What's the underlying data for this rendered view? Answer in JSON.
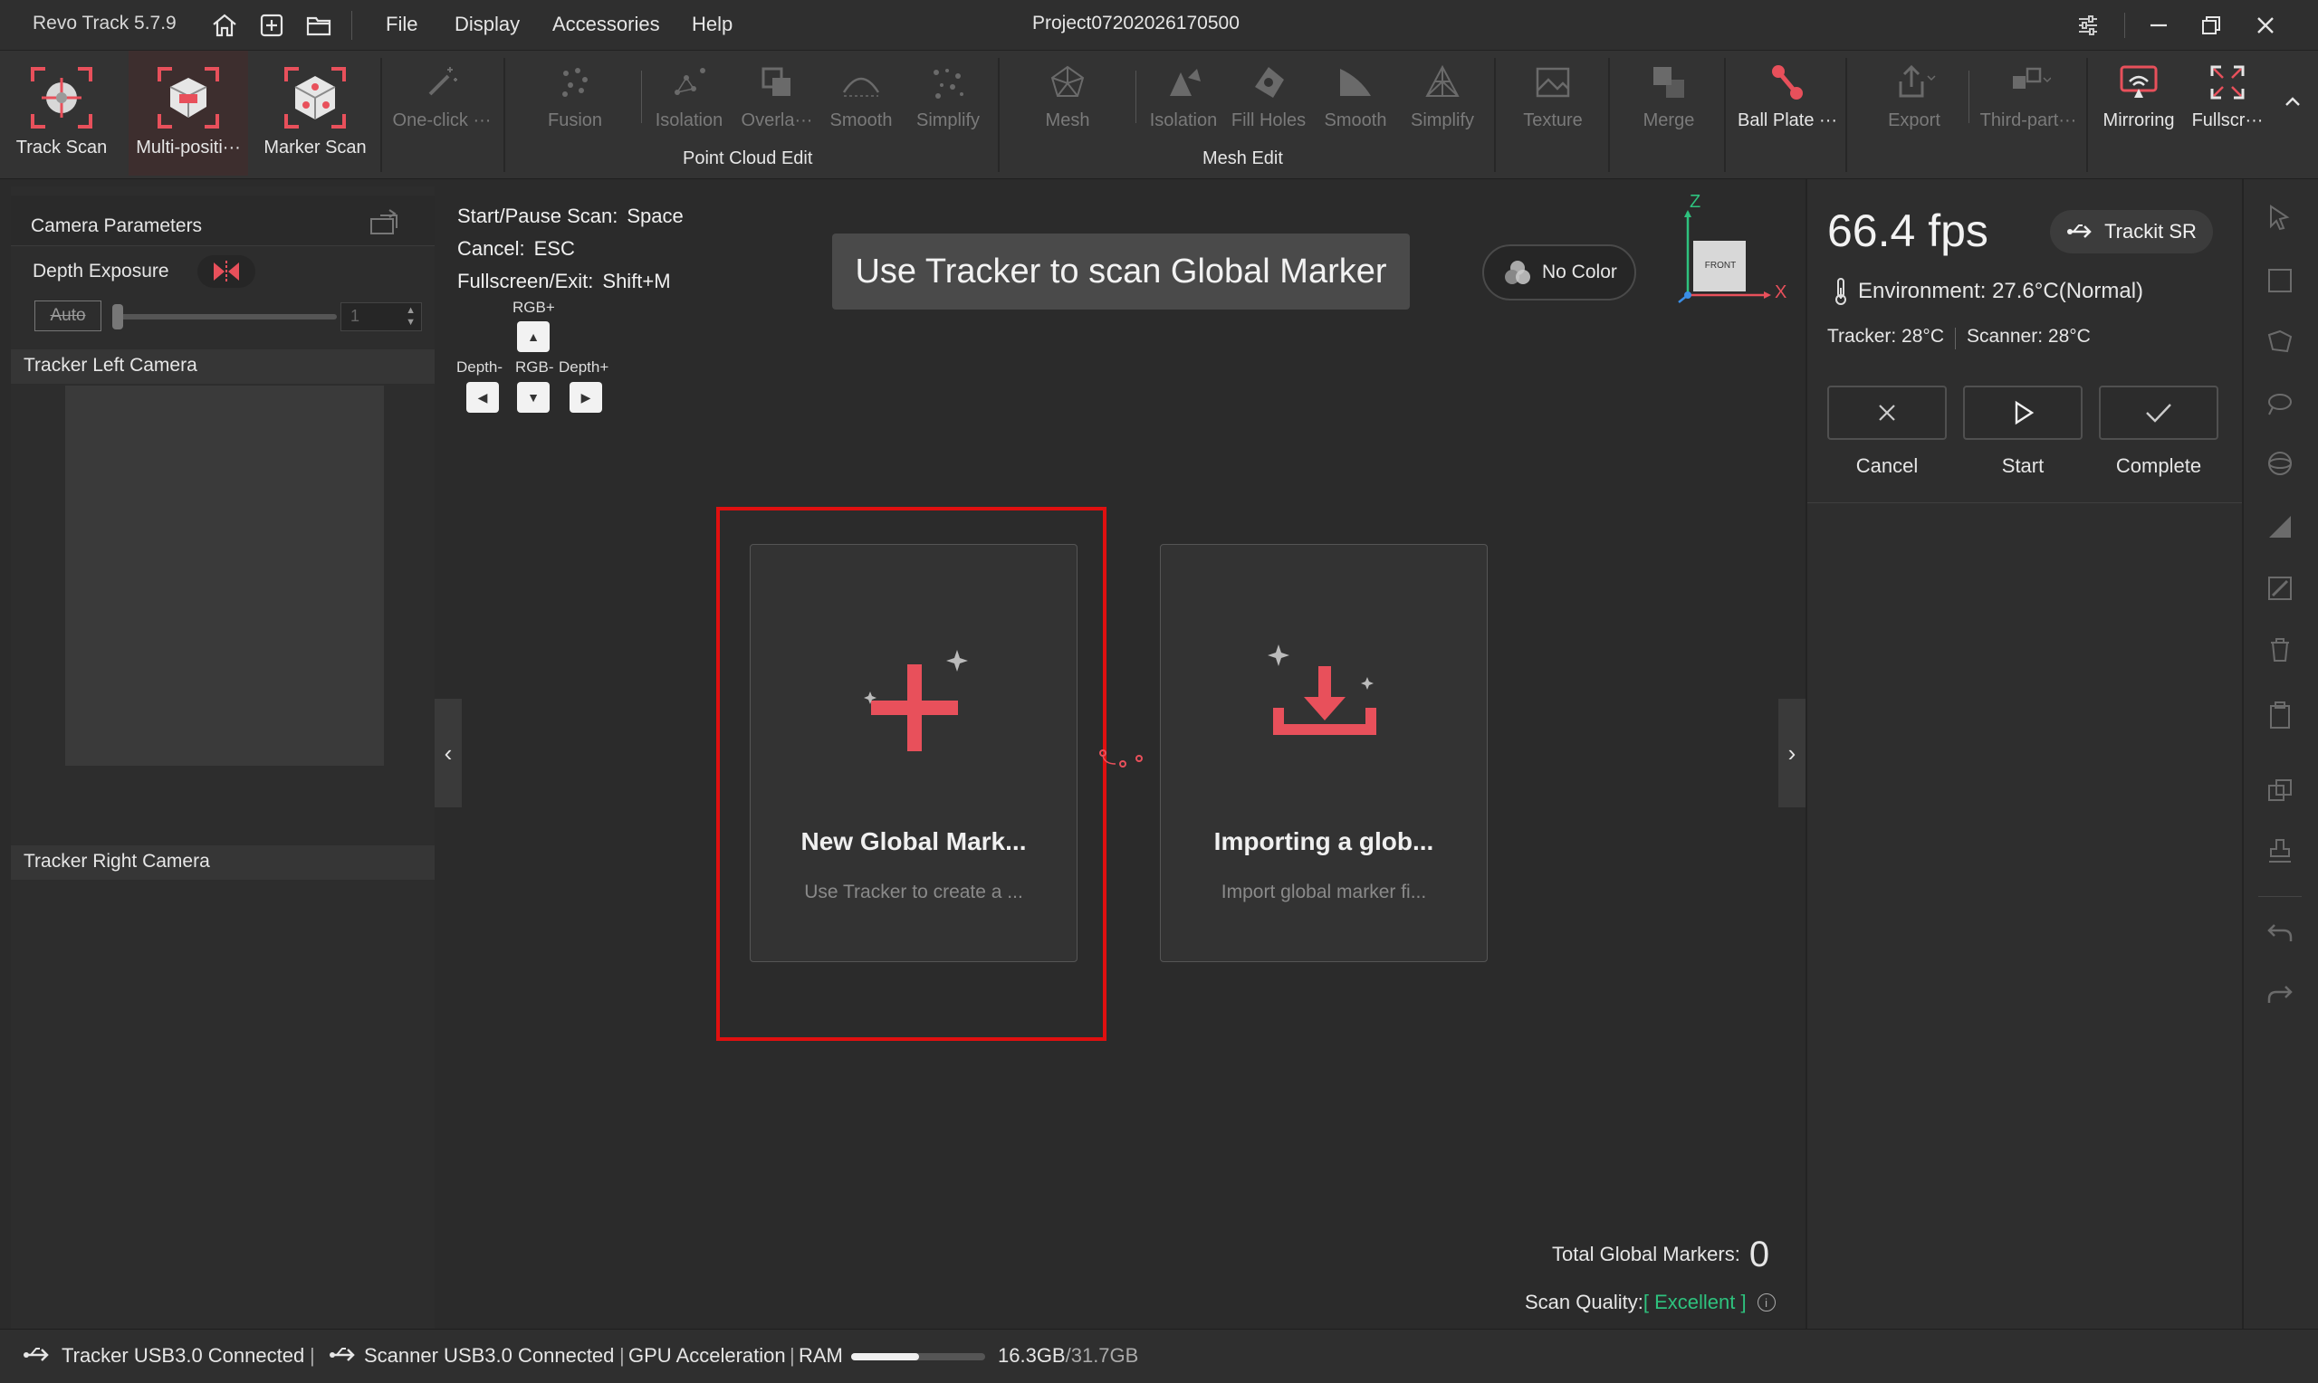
{
  "titlebar": {
    "app_title": "Revo Track 5.7.9",
    "menu": [
      "File",
      "Display",
      "Accessories",
      "Help"
    ],
    "project": "Project07202026170500"
  },
  "toolbar": {
    "scan_modes": [
      "Track Scan",
      "Multi-positi···",
      "Marker Scan"
    ],
    "one_click": "One-click ···",
    "point_cloud_tools": [
      "Fusion",
      "Isolation",
      "Overla···",
      "Smooth",
      "Simplify"
    ],
    "point_cloud_group": "Point Cloud Edit",
    "mesh_tools": [
      "Mesh",
      "Isolation",
      "Fill Holes",
      "Smooth",
      "Simplify"
    ],
    "mesh_group": "Mesh Edit",
    "texture": "Texture",
    "merge": "Merge",
    "ball_plate": "Ball Plate ···",
    "export": "Export",
    "third_party": "Third-part···",
    "mirroring": "Mirroring",
    "fullscreen": "Fullscr···"
  },
  "left_panel": {
    "camera_params": "Camera Parameters",
    "depth_exposure": "Depth Exposure",
    "auto": "Auto",
    "exposure_value": "1",
    "left_camera": "Tracker Left Camera",
    "right_camera": "Tracker Right Camera"
  },
  "viewport": {
    "hotkeys": [
      {
        "label": "Start/Pause Scan:",
        "value": "Space"
      },
      {
        "label": "Cancel:",
        "value": "ESC"
      },
      {
        "label": "Fullscreen/Exit:",
        "value": "Shift+M"
      }
    ],
    "arrow_labels": {
      "up": "RGB+",
      "left": "Depth-",
      "down": "RGB-",
      "right": "Depth+"
    },
    "banner": "Use Tracker to scan Global Marker",
    "color_mode": "No Color",
    "axis": {
      "z": "Z",
      "x": "X",
      "cube": "FRONT"
    },
    "cards": [
      {
        "title": "New Global Mark...",
        "desc": "Use Tracker to create a ..."
      },
      {
        "title": "Importing a glob...",
        "desc": "Import global marker fi..."
      }
    ],
    "total_markers_label": "Total Global Markers:",
    "total_markers_value": "0",
    "scan_quality_label": "Scan Quality:",
    "scan_quality_value": "[ Excellent ]"
  },
  "right_panel": {
    "fps": "66.4 fps",
    "device": "Trackit SR",
    "environment": "Environment: 27.6°C(Normal)",
    "tracker_temp": "Tracker: 28°C",
    "scanner_temp": "Scanner: 28°C",
    "actions": [
      "Cancel",
      "Start",
      "Complete"
    ]
  },
  "statusbar": {
    "tracker": "Tracker USB3.0 Connected",
    "scanner": "Scanner USB3.0 Connected",
    "gpu": "GPU Acceleration",
    "ram_label": "RAM",
    "ram_used": "16.3GB",
    "ram_total": "/31.7GB",
    "ram_fraction": 0.51
  },
  "colors": {
    "accent": "#e8505b",
    "highlight": "#e01010",
    "quality": "#2ec27e"
  }
}
